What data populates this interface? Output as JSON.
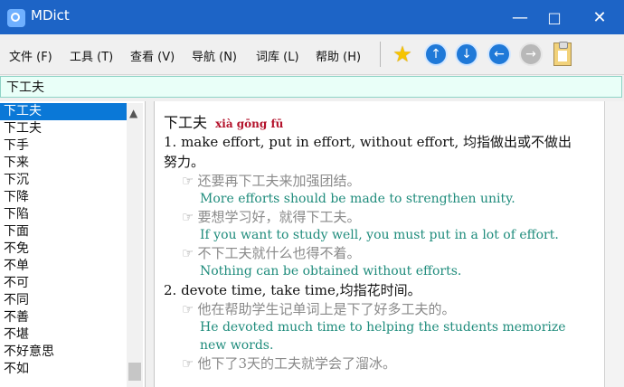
{
  "window": {
    "title": "MDict",
    "minimize": "—",
    "maximize": "□",
    "close": "✕"
  },
  "menu": [
    {
      "label": "文件 (F)"
    },
    {
      "label": "工具 (T)"
    },
    {
      "label": "查看 (V)"
    },
    {
      "label": "导航 (N)"
    },
    {
      "label": "词库 (L)"
    },
    {
      "label": "帮助 (H)"
    }
  ],
  "toolbar": {
    "icons": [
      "star-icon",
      "up-arrow-icon",
      "down-arrow-icon",
      "back-arrow-icon",
      "forward-arrow-icon",
      "clipboard-icon"
    ]
  },
  "search": {
    "value": "下工夫"
  },
  "word_list": {
    "items": [
      "下工夫",
      "下工夫",
      "下手",
      "下来",
      "下沉",
      "下降",
      "下陷",
      "下面",
      "不免",
      "不单",
      "不可",
      "不同",
      "不善",
      "不堪",
      "不好意思",
      "不如"
    ]
  },
  "entry": {
    "headword": "下工夫",
    "pinyin": "xià gōng fū",
    "senses": [
      {
        "text": "1. make effort, put in effort, without effort, 均指做出或不做出努力。",
        "examples": [
          {
            "cn": "还要再下工夫来加强团结。",
            "en": "More efforts should be made to strengthen unity."
          },
          {
            "cn": "要想学习好，就得下工夫。",
            "en": "If you want to study well, you must put in a lot of effort."
          },
          {
            "cn": "不下工夫就什么也得不着。",
            "en": "Nothing can be obtained without efforts."
          }
        ]
      },
      {
        "text": "2. devote time, take time,均指花时间。",
        "examples": [
          {
            "cn": "他在帮助学生记单词上是下了好多工夫的。",
            "en": "He devoted much time to helping the students memorize new words."
          },
          {
            "cn": "他下了3天的工夫就学会了溜冰。",
            "en": ""
          }
        ]
      }
    ]
  }
}
